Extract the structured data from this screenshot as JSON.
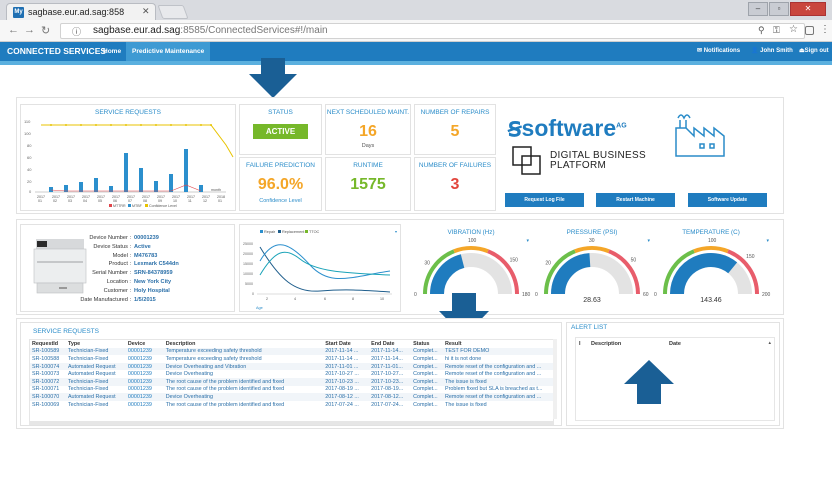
{
  "browser": {
    "tab_title": "sagbase.eur.ad.sag:858",
    "favicon": "My",
    "url_host": "sagbase.eur.ad.sag",
    "url_rest": ":8585/ConnectedServices#!/main"
  },
  "header": {
    "title": "CONNECTED SERVICES",
    "nav": [
      "Home",
      "Predictive Maintenance"
    ],
    "notifications": "Notifications",
    "user": "John Smith",
    "signout": "Sign out"
  },
  "service_requests_chart": {
    "title": "SERVICE REQUESTS",
    "x_axis_label": "month",
    "legend": [
      "MTTRR",
      "MTBF",
      "Confidence Level"
    ]
  },
  "kpis": {
    "status_label": "STATUS",
    "status_value": "ACTIVE",
    "next_maint_label": "NEXT SCHEDULED MAINT.",
    "next_maint_value": "16",
    "next_maint_unit": "Days",
    "repairs_label": "NUMBER OF REPAIRS",
    "repairs_value": "5",
    "failure_pred_label": "FAILURE PREDICTION",
    "failure_pred_value": "96.0%",
    "failure_pred_sub": "Confidence Level",
    "runtime_label": "RUNTIME",
    "runtime_value": "1575",
    "failures_label": "NUMBER OF FAILURES",
    "failures_value": "3"
  },
  "brand": {
    "logo_text": "software",
    "logo_sup": "AG",
    "platform_line1": "DIGITAL BUSINESS",
    "platform_line2": "PLATFORM"
  },
  "actions": {
    "request_log": "Request Log File",
    "restart": "Restart Machine",
    "update": "Software Update"
  },
  "device": {
    "rows": [
      {
        "label": "Device Number :",
        "value": "00001239"
      },
      {
        "label": "Device Status :",
        "value": "Active"
      },
      {
        "label": "Model :",
        "value": "M476783"
      },
      {
        "label": "Product :",
        "value": "Lexmark C544dn"
      },
      {
        "label": "Serial Number :",
        "value": "SRN-84378959"
      },
      {
        "label": "Location :",
        "value": "New York City"
      },
      {
        "label": "Customer :",
        "value": "Holy Hospital"
      },
      {
        "label": "Date Manufactured :",
        "value": "1/5/2015"
      }
    ]
  },
  "trend_chart": {
    "legend": [
      "Repair",
      "Replacement",
      "TTOC"
    ],
    "xlabel": "Age"
  },
  "gauges": [
    {
      "title": "VIBRATION (Hz)",
      "min": "0",
      "max": "180",
      "ticks": [
        "30",
        "100",
        "150"
      ],
      "value": "",
      "fill": 0.42
    },
    {
      "title": "PRESSURE (PSI)",
      "min": "0",
      "max": "60",
      "ticks": [
        "20",
        "30",
        "50"
      ],
      "value": "28.63",
      "fill": 0.48
    },
    {
      "title": "TEMPERATURE (C)",
      "min": "0",
      "max": "200",
      "ticks": [
        "100",
        "150"
      ],
      "value": "143.46",
      "fill": 0.72
    }
  ],
  "requests_table": {
    "title": "SERVICE REQUESTS",
    "columns": [
      "RequestId",
      "Type",
      "Device",
      "Description",
      "Start Date",
      "End Date",
      "Status",
      "Result"
    ],
    "rows": [
      [
        "SR-100589",
        "Technician-Fixed",
        "00001239",
        "Temperature exceeding safety threshold",
        "2017-11-14 ...",
        "2017-11-14...",
        "Complet...",
        "TEST FOR DEMO"
      ],
      [
        "SR-100588",
        "Technician-Fixed",
        "00001239",
        "Temperature exceeding safety threshold",
        "2017-11-14 ...",
        "2017-11-14...",
        "Complet...",
        "hi it is not done"
      ],
      [
        "SR-100074",
        "Automated Request",
        "00001239",
        "Device Overheating and Vibration",
        "2017-11-01 ...",
        "2017-11-01...",
        "Complet...",
        "Remote reset of the configuration and ..."
      ],
      [
        "SR-100073",
        "Automated Request",
        "00001239",
        "Device Overheating",
        "2017-10-27 ...",
        "2017-10-27...",
        "Complet...",
        "Remote reset of the configuration and ..."
      ],
      [
        "SR-100072",
        "Technician-Fixed",
        "00001239",
        "The root cause of the problem identified and fixed",
        "2017-10-23 ...",
        "2017-10-23...",
        "Complet...",
        "The issue is fixed"
      ],
      [
        "SR-100071",
        "Technician-Fixed",
        "00001239",
        "The root cause of the problem identified and fixed",
        "2017-08-19 ...",
        "2017-08-19...",
        "Complet...",
        "Problem fixed but SLA is breached as t..."
      ],
      [
        "SR-100070",
        "Automated Request",
        "00001239",
        "Device Overheating",
        "2017-08-12 ...",
        "2017-08-12...",
        "Complet...",
        "Remote reset of the configuration and ..."
      ],
      [
        "SR-100069",
        "Technician-Fixed",
        "00001239",
        "The root cause of the problem identified and fixed",
        "2017-07-24 ...",
        "2017-07-24...",
        "Complet...",
        "The issue is fixed"
      ]
    ]
  },
  "alert_list": {
    "title": "ALERT LIST",
    "columns": [
      "I",
      "Description",
      "Date"
    ]
  },
  "colors": {
    "primary": "#1f7cbf",
    "arrow": "#1a5f95",
    "active_green": "#76b82a",
    "orange": "#f4a628",
    "red": "#e2453c"
  }
}
